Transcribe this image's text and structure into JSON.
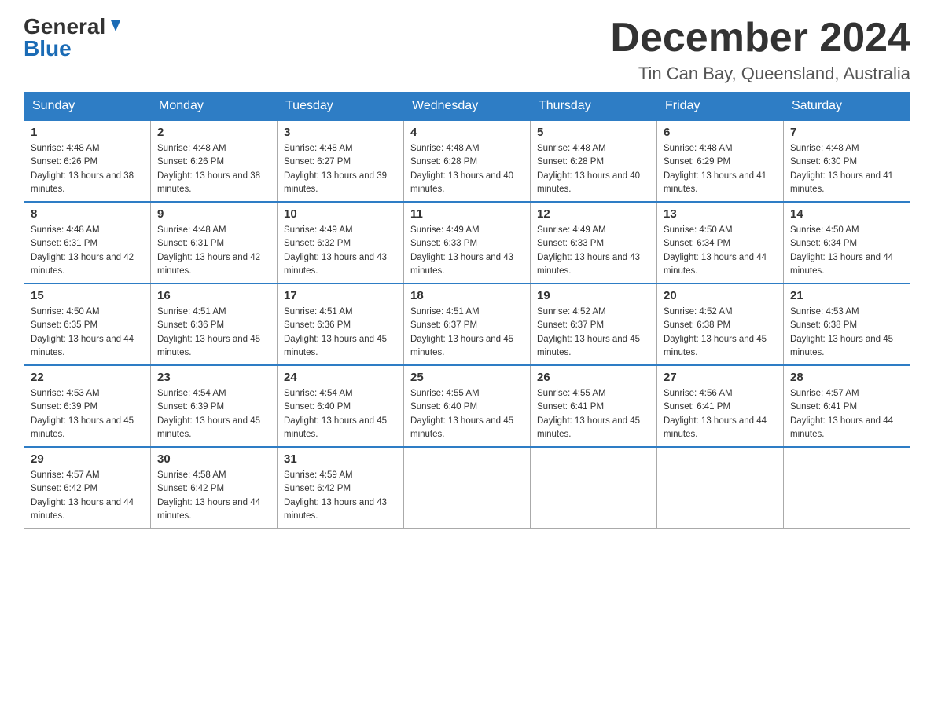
{
  "header": {
    "logo_general": "General",
    "logo_blue": "Blue",
    "month_title": "December 2024",
    "location": "Tin Can Bay, Queensland, Australia"
  },
  "days_of_week": [
    "Sunday",
    "Monday",
    "Tuesday",
    "Wednesday",
    "Thursday",
    "Friday",
    "Saturday"
  ],
  "weeks": [
    [
      {
        "day": "1",
        "sunrise": "4:48 AM",
        "sunset": "6:26 PM",
        "daylight": "13 hours and 38 minutes."
      },
      {
        "day": "2",
        "sunrise": "4:48 AM",
        "sunset": "6:26 PM",
        "daylight": "13 hours and 38 minutes."
      },
      {
        "day": "3",
        "sunrise": "4:48 AM",
        "sunset": "6:27 PM",
        "daylight": "13 hours and 39 minutes."
      },
      {
        "day": "4",
        "sunrise": "4:48 AM",
        "sunset": "6:28 PM",
        "daylight": "13 hours and 40 minutes."
      },
      {
        "day": "5",
        "sunrise": "4:48 AM",
        "sunset": "6:28 PM",
        "daylight": "13 hours and 40 minutes."
      },
      {
        "day": "6",
        "sunrise": "4:48 AM",
        "sunset": "6:29 PM",
        "daylight": "13 hours and 41 minutes."
      },
      {
        "day": "7",
        "sunrise": "4:48 AM",
        "sunset": "6:30 PM",
        "daylight": "13 hours and 41 minutes."
      }
    ],
    [
      {
        "day": "8",
        "sunrise": "4:48 AM",
        "sunset": "6:31 PM",
        "daylight": "13 hours and 42 minutes."
      },
      {
        "day": "9",
        "sunrise": "4:48 AM",
        "sunset": "6:31 PM",
        "daylight": "13 hours and 42 minutes."
      },
      {
        "day": "10",
        "sunrise": "4:49 AM",
        "sunset": "6:32 PM",
        "daylight": "13 hours and 43 minutes."
      },
      {
        "day": "11",
        "sunrise": "4:49 AM",
        "sunset": "6:33 PM",
        "daylight": "13 hours and 43 minutes."
      },
      {
        "day": "12",
        "sunrise": "4:49 AM",
        "sunset": "6:33 PM",
        "daylight": "13 hours and 43 minutes."
      },
      {
        "day": "13",
        "sunrise": "4:50 AM",
        "sunset": "6:34 PM",
        "daylight": "13 hours and 44 minutes."
      },
      {
        "day": "14",
        "sunrise": "4:50 AM",
        "sunset": "6:34 PM",
        "daylight": "13 hours and 44 minutes."
      }
    ],
    [
      {
        "day": "15",
        "sunrise": "4:50 AM",
        "sunset": "6:35 PM",
        "daylight": "13 hours and 44 minutes."
      },
      {
        "day": "16",
        "sunrise": "4:51 AM",
        "sunset": "6:36 PM",
        "daylight": "13 hours and 45 minutes."
      },
      {
        "day": "17",
        "sunrise": "4:51 AM",
        "sunset": "6:36 PM",
        "daylight": "13 hours and 45 minutes."
      },
      {
        "day": "18",
        "sunrise": "4:51 AM",
        "sunset": "6:37 PM",
        "daylight": "13 hours and 45 minutes."
      },
      {
        "day": "19",
        "sunrise": "4:52 AM",
        "sunset": "6:37 PM",
        "daylight": "13 hours and 45 minutes."
      },
      {
        "day": "20",
        "sunrise": "4:52 AM",
        "sunset": "6:38 PM",
        "daylight": "13 hours and 45 minutes."
      },
      {
        "day": "21",
        "sunrise": "4:53 AM",
        "sunset": "6:38 PM",
        "daylight": "13 hours and 45 minutes."
      }
    ],
    [
      {
        "day": "22",
        "sunrise": "4:53 AM",
        "sunset": "6:39 PM",
        "daylight": "13 hours and 45 minutes."
      },
      {
        "day": "23",
        "sunrise": "4:54 AM",
        "sunset": "6:39 PM",
        "daylight": "13 hours and 45 minutes."
      },
      {
        "day": "24",
        "sunrise": "4:54 AM",
        "sunset": "6:40 PM",
        "daylight": "13 hours and 45 minutes."
      },
      {
        "day": "25",
        "sunrise": "4:55 AM",
        "sunset": "6:40 PM",
        "daylight": "13 hours and 45 minutes."
      },
      {
        "day": "26",
        "sunrise": "4:55 AM",
        "sunset": "6:41 PM",
        "daylight": "13 hours and 45 minutes."
      },
      {
        "day": "27",
        "sunrise": "4:56 AM",
        "sunset": "6:41 PM",
        "daylight": "13 hours and 44 minutes."
      },
      {
        "day": "28",
        "sunrise": "4:57 AM",
        "sunset": "6:41 PM",
        "daylight": "13 hours and 44 minutes."
      }
    ],
    [
      {
        "day": "29",
        "sunrise": "4:57 AM",
        "sunset": "6:42 PM",
        "daylight": "13 hours and 44 minutes."
      },
      {
        "day": "30",
        "sunrise": "4:58 AM",
        "sunset": "6:42 PM",
        "daylight": "13 hours and 44 minutes."
      },
      {
        "day": "31",
        "sunrise": "4:59 AM",
        "sunset": "6:42 PM",
        "daylight": "13 hours and 43 minutes."
      },
      null,
      null,
      null,
      null
    ]
  ]
}
